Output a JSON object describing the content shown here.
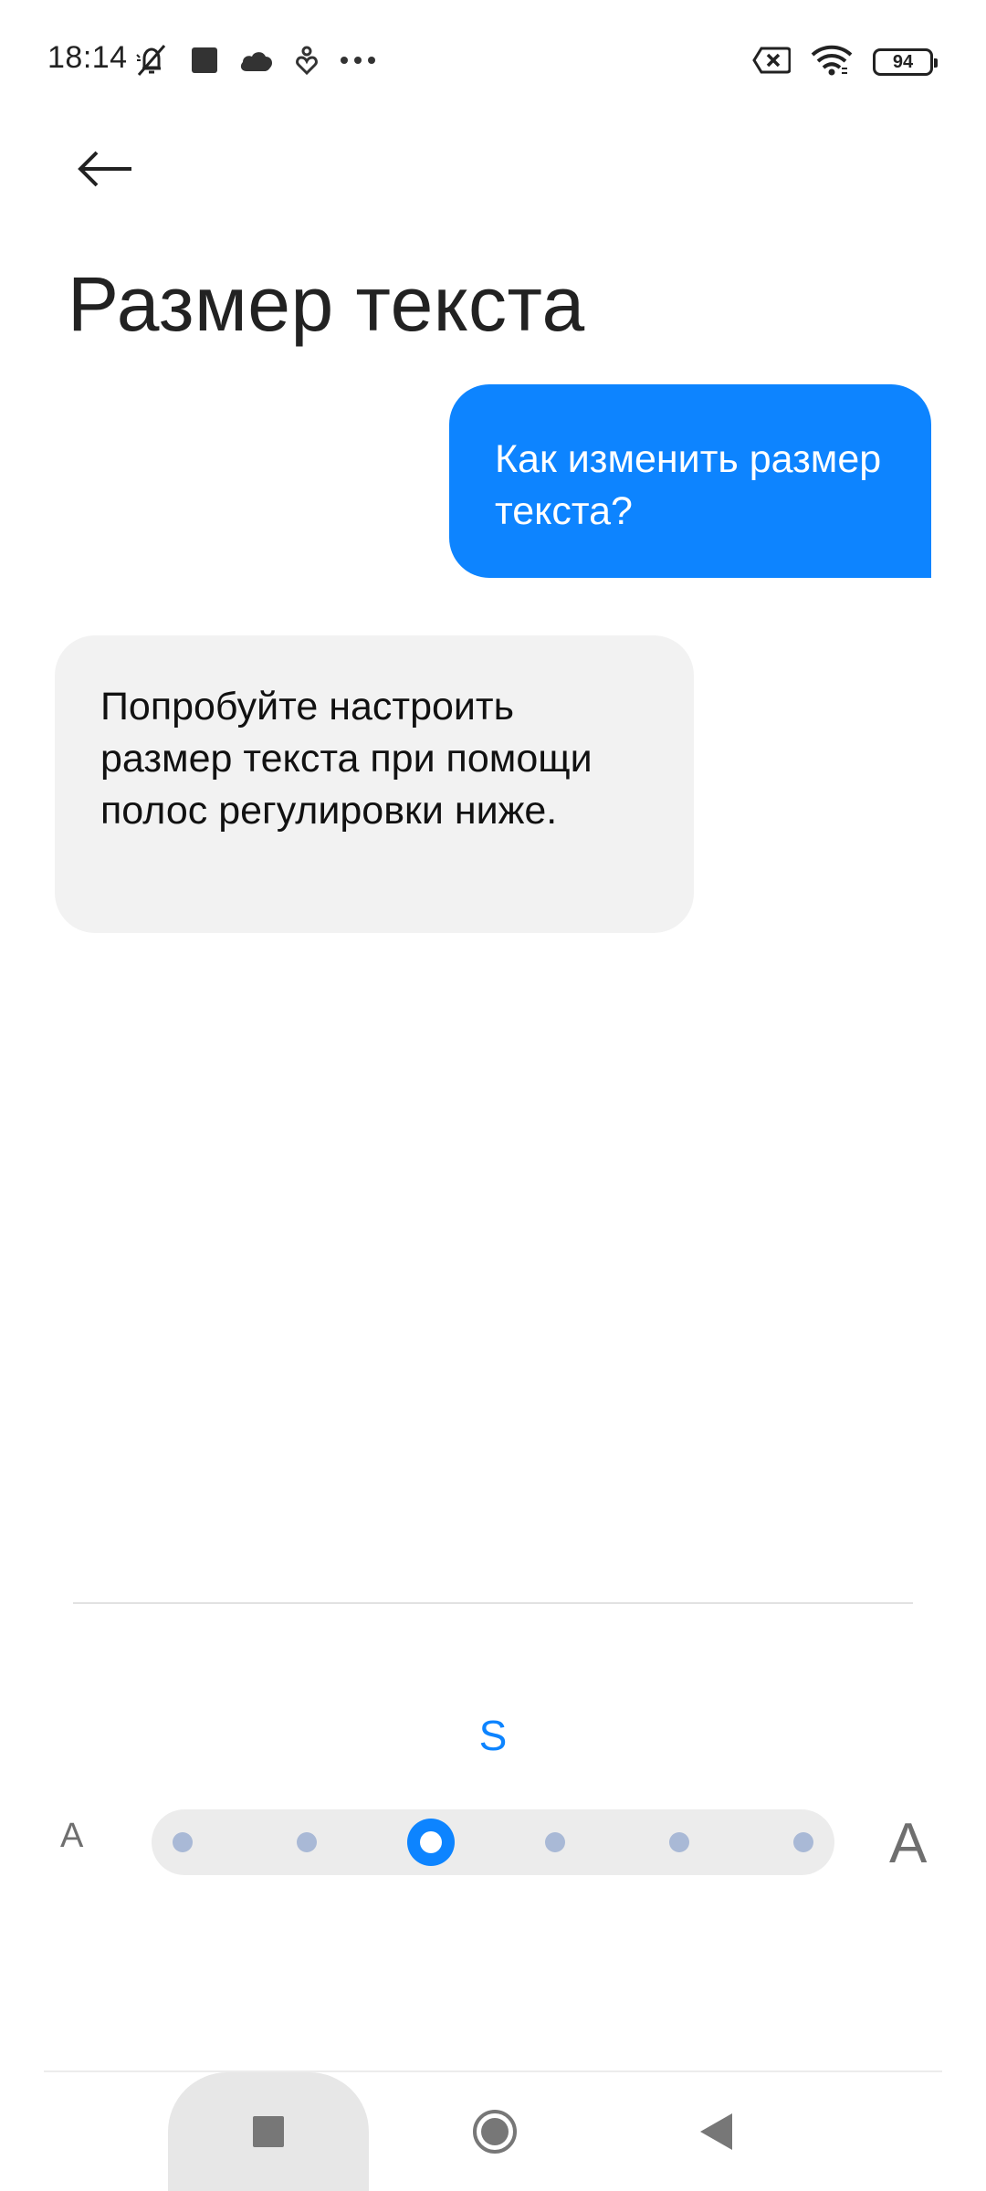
{
  "status_bar": {
    "time": "18:14",
    "icons_left": [
      "mute-icon",
      "square-notification-icon",
      "cloud-icon",
      "location-heart-icon",
      "more-dots-icon"
    ],
    "icons_right": [
      "no-sim-icon",
      "wifi-icon",
      "battery-icon"
    ],
    "battery_level": "94"
  },
  "header": {
    "back_icon": "arrow-left-icon",
    "title": "Размер текста"
  },
  "chat": {
    "outgoing": "Как изменить размер текста?",
    "incoming": "Попробуйте настроить размер текста при помощи полос регулировки ниже."
  },
  "text_size": {
    "current_label": "S",
    "small_a": "A",
    "large_a": "A",
    "levels": 6,
    "selected_index": 2
  },
  "nav_bar": {
    "recents_icon": "square-recents-icon",
    "home_icon": "circle-home-icon",
    "back_icon": "triangle-back-icon"
  },
  "colors": {
    "accent": "#0d84ff",
    "bubble_incoming": "#f2f2f2",
    "slider_track": "#ececec",
    "slider_dot": "#a9b9d6"
  }
}
